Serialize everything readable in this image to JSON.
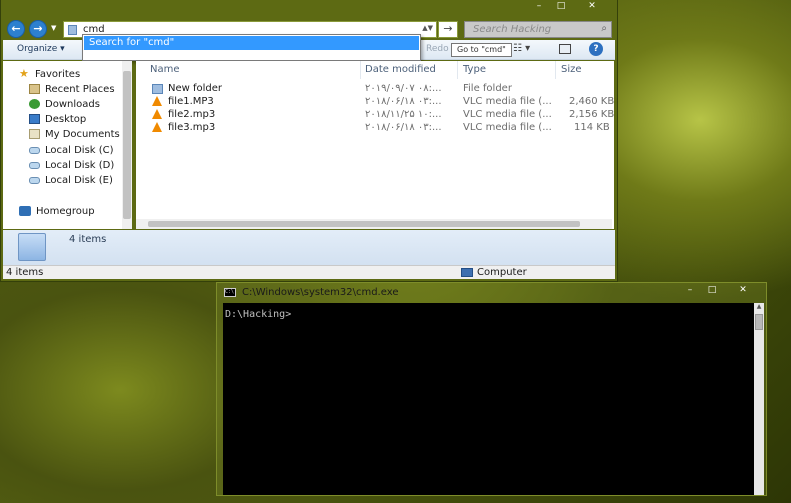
{
  "explorer": {
    "window_controls": [
      "–",
      "□",
      "✕"
    ],
    "address": {
      "value": "cmd"
    },
    "search": {
      "placeholder": "Search Hacking"
    },
    "suggestion": "Search for \"cmd\"",
    "tooltip": "Go to \"cmd\"",
    "toolbar": {
      "organize": "Organize ▾",
      "redo": "Redo"
    },
    "nav": {
      "favorites": "Favorites",
      "items": [
        {
          "label": "Recent Places",
          "icon": "recent-places-icon"
        },
        {
          "label": "Downloads",
          "icon": "downloads-icon"
        },
        {
          "label": "Desktop",
          "icon": "desktop-icon"
        },
        {
          "label": "My Documents",
          "icon": "documents-icon"
        },
        {
          "label": "Local Disk (C)",
          "icon": "drive-icon"
        },
        {
          "label": "Local Disk (D)",
          "icon": "drive-icon"
        },
        {
          "label": "Local Disk (E)",
          "icon": "drive-icon"
        }
      ],
      "homegroup": "Homegroup"
    },
    "columns": {
      "name": "Name",
      "date": "Date modified",
      "type": "Type",
      "size": "Size"
    },
    "files": [
      {
        "name": "New folder",
        "date": "۲۰۱۹/۰۹/۰۷ ۰۸:...",
        "type": "File folder",
        "size": "",
        "icon": "folder-icon"
      },
      {
        "name": "file1.MP3",
        "date": "۲۰۱۸/۰۶/۱۸ ۰۳:...",
        "type": "VLC media file (...",
        "size": "2,460 KB",
        "icon": "vlc-icon"
      },
      {
        "name": "file2.mp3",
        "date": "۲۰۱۸/۱۱/۲۵ ۱۰:...",
        "type": "VLC media file (...",
        "size": "2,156 KB",
        "icon": "vlc-icon"
      },
      {
        "name": "file3.mp3",
        "date": "۲۰۱۸/۰۶/۱۸ ۰۳:...",
        "type": "VLC media file (...",
        "size": "114 KB",
        "icon": "vlc-icon"
      }
    ],
    "details": {
      "count": "4 items"
    },
    "status": {
      "left": "4 items",
      "right": "Computer"
    }
  },
  "cmd": {
    "title": "C:\\Windows\\system32\\cmd.exe",
    "window_controls": [
      "–",
      "□",
      "✕"
    ],
    "prompt": "D:\\Hacking>"
  },
  "colors": {
    "selection": "#3399ff",
    "vlc": "#f08a00",
    "console_bg": "#000000",
    "console_text": "#c0c0c0"
  }
}
